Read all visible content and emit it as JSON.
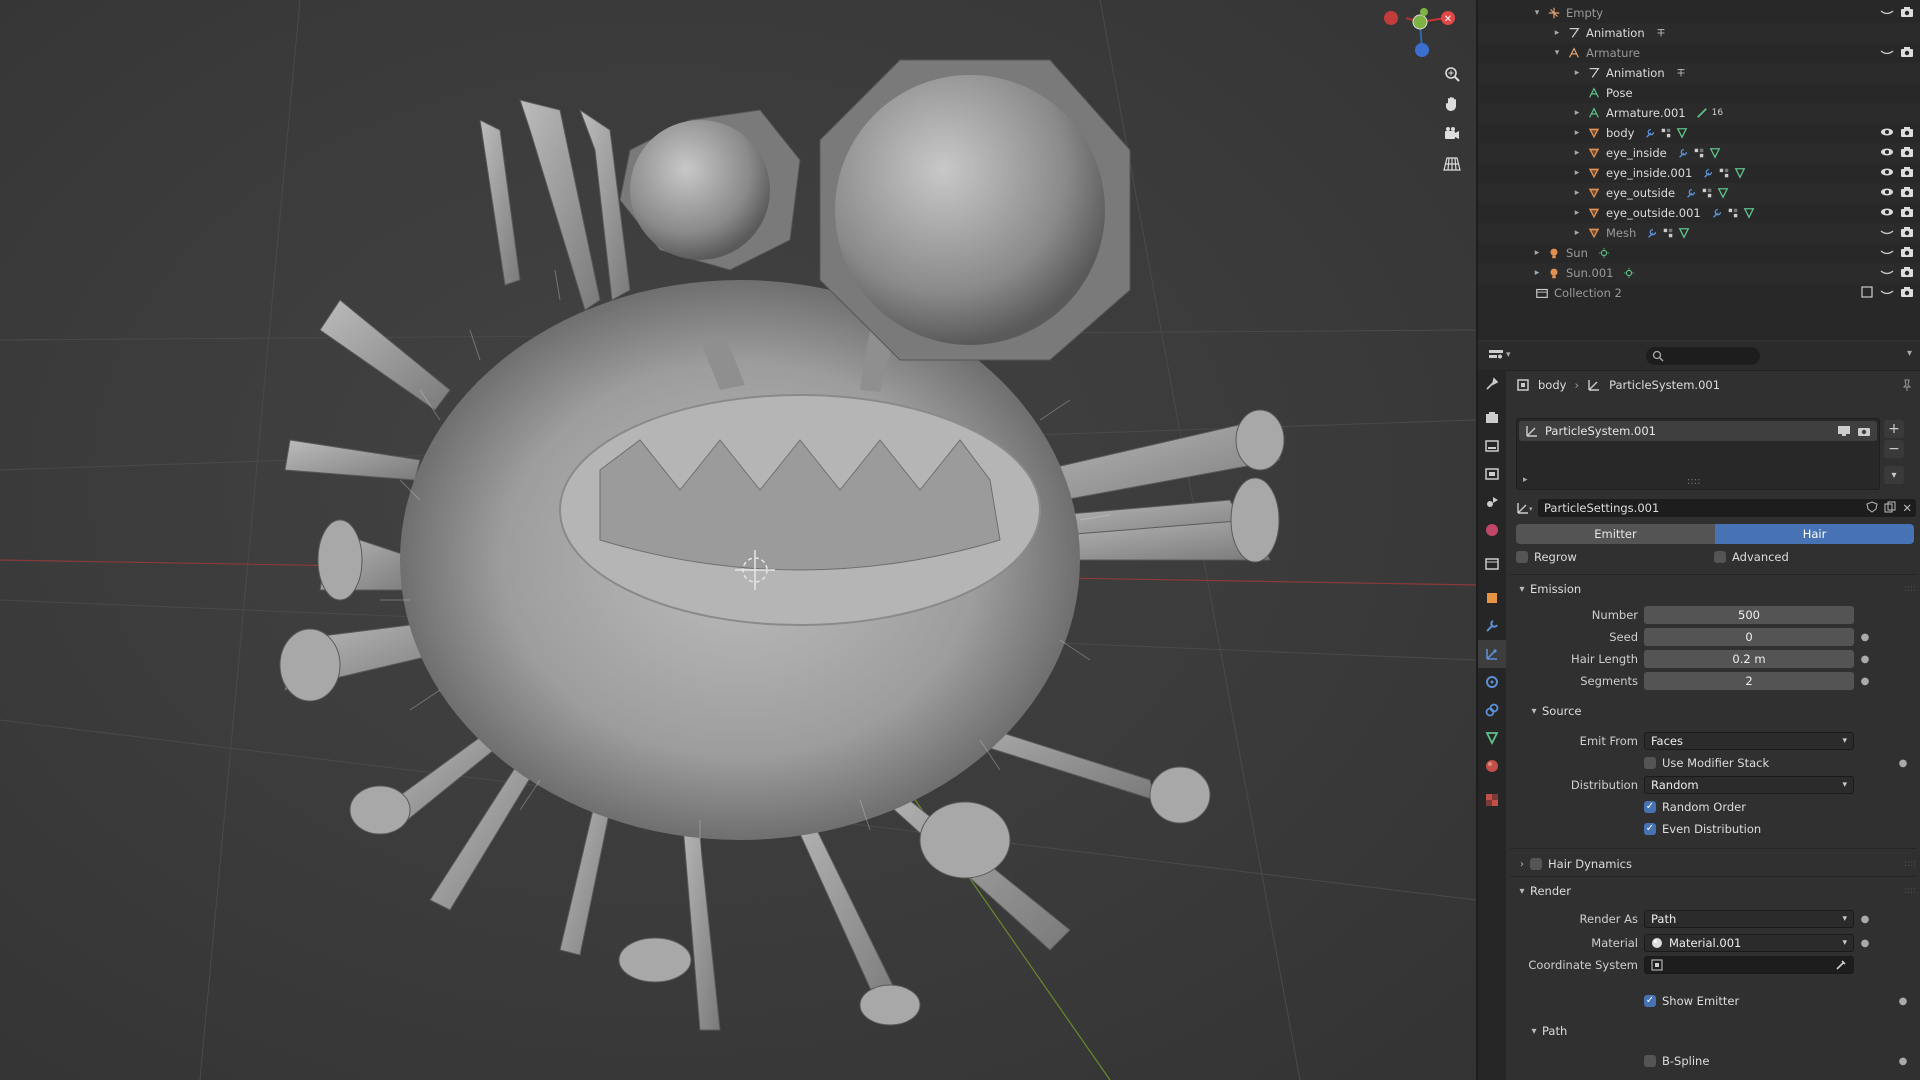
{
  "outliner": {
    "rows": [
      {
        "label": "Empty",
        "indent": 0,
        "icon": "empty-icon",
        "dim": true,
        "arrow": "▾"
      },
      {
        "label": "Animation",
        "indent": 1,
        "icon": "animation-icon",
        "dim": false,
        "arrow": "▸"
      },
      {
        "label": "Armature",
        "indent": 1,
        "icon": "armature-icon",
        "dim": true,
        "arrow": "▾"
      },
      {
        "label": "Animation",
        "indent": 2,
        "icon": "animation-icon",
        "dim": false,
        "arrow": "▸"
      },
      {
        "label": "Pose",
        "indent": 2,
        "icon": "pose-icon",
        "dim": false,
        "arrow": ""
      },
      {
        "label": "Armature.001",
        "indent": 2,
        "icon": "armature-data-icon",
        "dim": false,
        "arrow": "▸",
        "extra": "16"
      },
      {
        "label": "body",
        "indent": 2,
        "icon": "mesh-object-icon",
        "dim": false,
        "arrow": "▸"
      },
      {
        "label": "eye_inside",
        "indent": 2,
        "icon": "mesh-object-icon",
        "dim": false,
        "arrow": "▸"
      },
      {
        "label": "eye_inside.001",
        "indent": 2,
        "icon": "mesh-object-icon",
        "dim": false,
        "arrow": "▸"
      },
      {
        "label": "eye_outside",
        "indent": 2,
        "icon": "mesh-object-icon",
        "dim": false,
        "arrow": "▸"
      },
      {
        "label": "eye_outside.001",
        "indent": 2,
        "icon": "mesh-object-icon",
        "dim": false,
        "arrow": "▸"
      },
      {
        "label": "Mesh",
        "indent": 2,
        "icon": "mesh-object-icon",
        "dim": true,
        "arrow": "▸"
      },
      {
        "label": "Sun",
        "indent": 0,
        "icon": "light-icon",
        "dim": true,
        "arrow": "▸"
      },
      {
        "label": "Sun.001",
        "indent": 0,
        "icon": "light-icon",
        "dim": true,
        "arrow": "▸"
      },
      {
        "label": "Collection 2",
        "indent": -1,
        "icon": "collection-icon",
        "dim": true,
        "arrow": ""
      }
    ]
  },
  "props": {
    "breadcrumb_object": "body",
    "breadcrumb_psys": "ParticleSystem.001",
    "psys_item": "ParticleSystem.001",
    "settings_name": "ParticleSettings.001",
    "type_emitter": "Emitter",
    "type_hair": "Hair",
    "regrow": "Regrow",
    "advanced": "Advanced",
    "emission": {
      "title": "Emission",
      "number_label": "Number",
      "number": "500",
      "seed_label": "Seed",
      "seed": "0",
      "hair_length_label": "Hair Length",
      "hair_length": "0.2 m",
      "segments_label": "Segments",
      "segments": "2"
    },
    "source": {
      "title": "Source",
      "emit_from_label": "Emit From",
      "emit_from": "Faces",
      "use_modifier_stack": "Use Modifier Stack",
      "distribution_label": "Distribution",
      "distribution": "Random",
      "random_order": "Random Order",
      "even_distribution": "Even Distribution"
    },
    "hair_dynamics": "Hair Dynamics",
    "render": {
      "title": "Render",
      "render_as_label": "Render As",
      "render_as": "Path",
      "material_label": "Material",
      "material": "Material.001",
      "coordinate_system_label": "Coordinate System",
      "show_emitter": "Show Emitter"
    },
    "path": {
      "title": "Path",
      "b_spline": "B-Spline"
    }
  },
  "colors": {
    "accent": "#4772b3",
    "mesh_icon": "#e09050",
    "data_icon": "#5fc28a"
  }
}
